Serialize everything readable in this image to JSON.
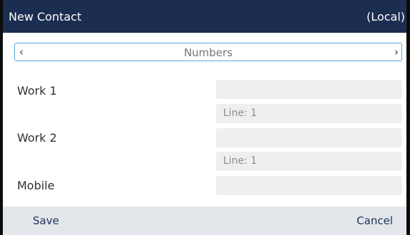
{
  "header": {
    "title": "New Contact",
    "scope": "(Local)"
  },
  "section_selector": {
    "label": "Numbers",
    "prev_icon": "chevron-left-icon",
    "next_icon": "chevron-right-icon",
    "prev_glyph": "‹",
    "next_glyph": "›"
  },
  "fields": [
    {
      "label": "Work 1",
      "value": "",
      "line": "Line: 1"
    },
    {
      "label": "Work 2",
      "value": "",
      "line": "Line: 1"
    },
    {
      "label": "Mobile",
      "value": ""
    }
  ],
  "softkeys": {
    "save_label": "Save",
    "cancel_label": "Cancel"
  },
  "colors": {
    "header_bg": "#1b2d50",
    "selector_border": "#5aa9d6",
    "softkey_bg": "#e3e6ea",
    "softkey_text": "#1d3358",
    "field_bg": "#efefef"
  }
}
